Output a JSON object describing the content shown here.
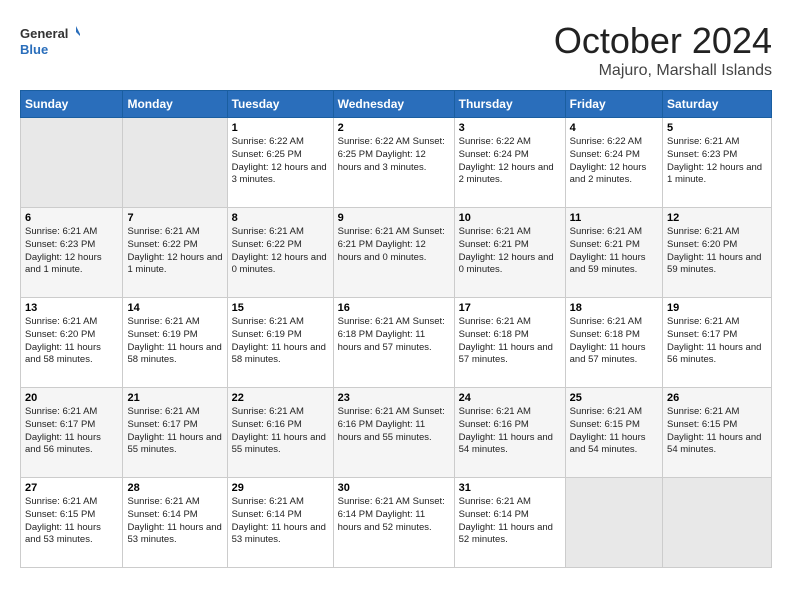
{
  "header": {
    "logo_line1": "General",
    "logo_line2": "Blue",
    "month": "October 2024",
    "location": "Majuro, Marshall Islands"
  },
  "days_of_week": [
    "Sunday",
    "Monday",
    "Tuesday",
    "Wednesday",
    "Thursday",
    "Friday",
    "Saturday"
  ],
  "weeks": [
    [
      {
        "day": "",
        "info": ""
      },
      {
        "day": "",
        "info": ""
      },
      {
        "day": "1",
        "info": "Sunrise: 6:22 AM\nSunset: 6:25 PM\nDaylight: 12 hours and 3 minutes."
      },
      {
        "day": "2",
        "info": "Sunrise: 6:22 AM\nSunset: 6:25 PM\nDaylight: 12 hours and 3 minutes."
      },
      {
        "day": "3",
        "info": "Sunrise: 6:22 AM\nSunset: 6:24 PM\nDaylight: 12 hours and 2 minutes."
      },
      {
        "day": "4",
        "info": "Sunrise: 6:22 AM\nSunset: 6:24 PM\nDaylight: 12 hours and 2 minutes."
      },
      {
        "day": "5",
        "info": "Sunrise: 6:21 AM\nSunset: 6:23 PM\nDaylight: 12 hours and 1 minute."
      }
    ],
    [
      {
        "day": "6",
        "info": "Sunrise: 6:21 AM\nSunset: 6:23 PM\nDaylight: 12 hours and 1 minute."
      },
      {
        "day": "7",
        "info": "Sunrise: 6:21 AM\nSunset: 6:22 PM\nDaylight: 12 hours and 1 minute."
      },
      {
        "day": "8",
        "info": "Sunrise: 6:21 AM\nSunset: 6:22 PM\nDaylight: 12 hours and 0 minutes."
      },
      {
        "day": "9",
        "info": "Sunrise: 6:21 AM\nSunset: 6:21 PM\nDaylight: 12 hours and 0 minutes."
      },
      {
        "day": "10",
        "info": "Sunrise: 6:21 AM\nSunset: 6:21 PM\nDaylight: 12 hours and 0 minutes."
      },
      {
        "day": "11",
        "info": "Sunrise: 6:21 AM\nSunset: 6:21 PM\nDaylight: 11 hours and 59 minutes."
      },
      {
        "day": "12",
        "info": "Sunrise: 6:21 AM\nSunset: 6:20 PM\nDaylight: 11 hours and 59 minutes."
      }
    ],
    [
      {
        "day": "13",
        "info": "Sunrise: 6:21 AM\nSunset: 6:20 PM\nDaylight: 11 hours and 58 minutes."
      },
      {
        "day": "14",
        "info": "Sunrise: 6:21 AM\nSunset: 6:19 PM\nDaylight: 11 hours and 58 minutes."
      },
      {
        "day": "15",
        "info": "Sunrise: 6:21 AM\nSunset: 6:19 PM\nDaylight: 11 hours and 58 minutes."
      },
      {
        "day": "16",
        "info": "Sunrise: 6:21 AM\nSunset: 6:18 PM\nDaylight: 11 hours and 57 minutes."
      },
      {
        "day": "17",
        "info": "Sunrise: 6:21 AM\nSunset: 6:18 PM\nDaylight: 11 hours and 57 minutes."
      },
      {
        "day": "18",
        "info": "Sunrise: 6:21 AM\nSunset: 6:18 PM\nDaylight: 11 hours and 57 minutes."
      },
      {
        "day": "19",
        "info": "Sunrise: 6:21 AM\nSunset: 6:17 PM\nDaylight: 11 hours and 56 minutes."
      }
    ],
    [
      {
        "day": "20",
        "info": "Sunrise: 6:21 AM\nSunset: 6:17 PM\nDaylight: 11 hours and 56 minutes."
      },
      {
        "day": "21",
        "info": "Sunrise: 6:21 AM\nSunset: 6:17 PM\nDaylight: 11 hours and 55 minutes."
      },
      {
        "day": "22",
        "info": "Sunrise: 6:21 AM\nSunset: 6:16 PM\nDaylight: 11 hours and 55 minutes."
      },
      {
        "day": "23",
        "info": "Sunrise: 6:21 AM\nSunset: 6:16 PM\nDaylight: 11 hours and 55 minutes."
      },
      {
        "day": "24",
        "info": "Sunrise: 6:21 AM\nSunset: 6:16 PM\nDaylight: 11 hours and 54 minutes."
      },
      {
        "day": "25",
        "info": "Sunrise: 6:21 AM\nSunset: 6:15 PM\nDaylight: 11 hours and 54 minutes."
      },
      {
        "day": "26",
        "info": "Sunrise: 6:21 AM\nSunset: 6:15 PM\nDaylight: 11 hours and 54 minutes."
      }
    ],
    [
      {
        "day": "27",
        "info": "Sunrise: 6:21 AM\nSunset: 6:15 PM\nDaylight: 11 hours and 53 minutes."
      },
      {
        "day": "28",
        "info": "Sunrise: 6:21 AM\nSunset: 6:14 PM\nDaylight: 11 hours and 53 minutes."
      },
      {
        "day": "29",
        "info": "Sunrise: 6:21 AM\nSunset: 6:14 PM\nDaylight: 11 hours and 53 minutes."
      },
      {
        "day": "30",
        "info": "Sunrise: 6:21 AM\nSunset: 6:14 PM\nDaylight: 11 hours and 52 minutes."
      },
      {
        "day": "31",
        "info": "Sunrise: 6:21 AM\nSunset: 6:14 PM\nDaylight: 11 hours and 52 minutes."
      },
      {
        "day": "",
        "info": ""
      },
      {
        "day": "",
        "info": ""
      }
    ]
  ]
}
